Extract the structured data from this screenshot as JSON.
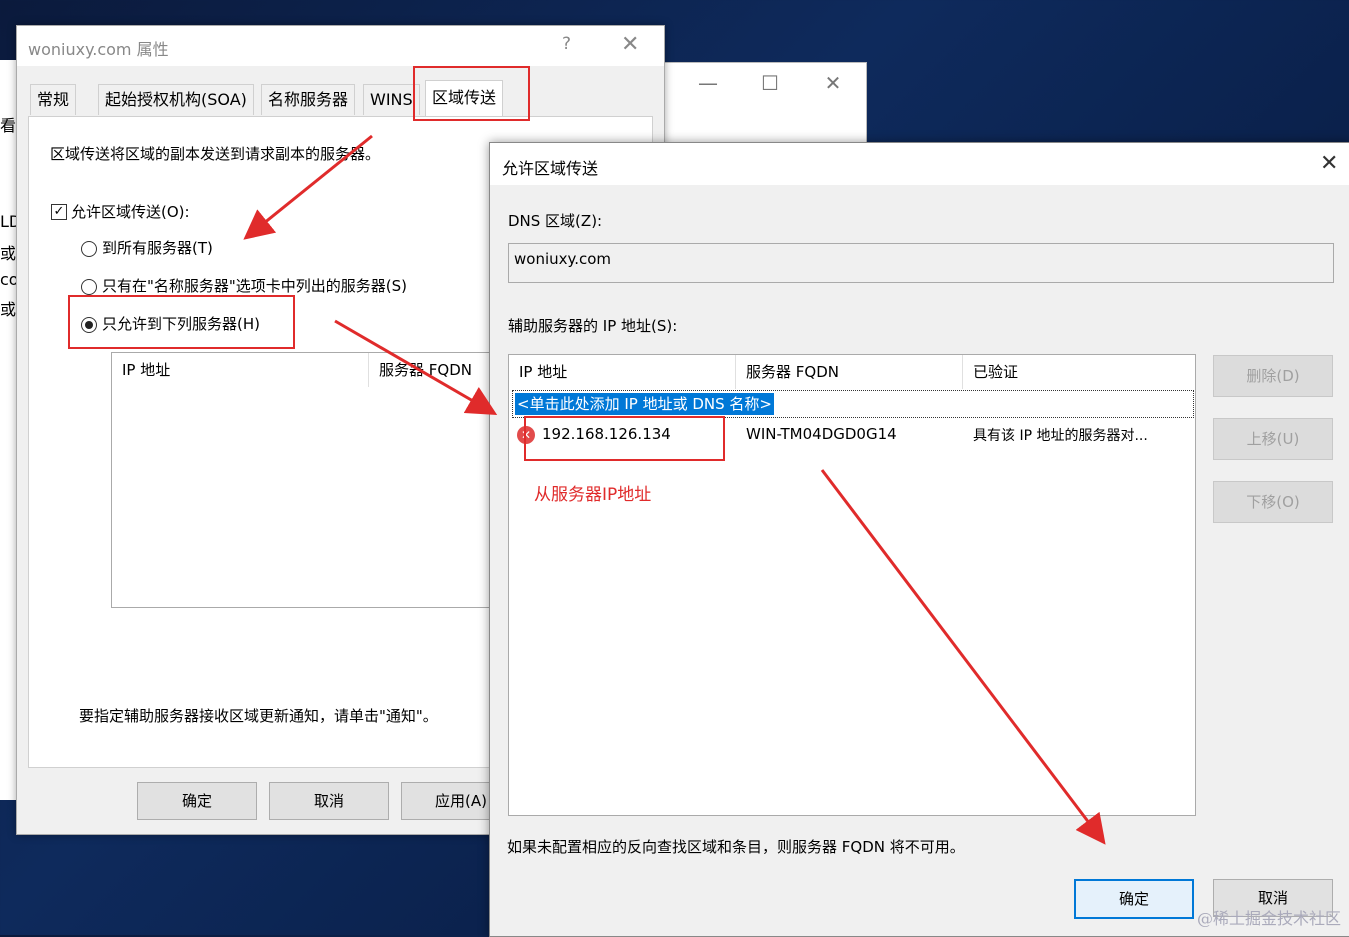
{
  "background": {
    "left_fragments": [
      "看",
      "LD",
      "或",
      "co",
      "或"
    ]
  },
  "props_dialog": {
    "title": "woniuxy.com 属性",
    "help": "?",
    "close": "✕",
    "tabs": [
      "常规",
      "起始授权机构(SOA)",
      "名称服务器",
      "WINS",
      "区域传送"
    ],
    "description": "区域传送将区域的副本发送到请求副本的服务器。",
    "allow_checkbox": "允许区域传送(O):",
    "radio_all": "到所有服务器(T)",
    "radio_ns": "只有在\"名称服务器\"选项卡中列出的服务器(S)",
    "radio_list": "只允许到下列服务器(H)",
    "list_headers": [
      "IP 地址",
      "服务器 FQDN"
    ],
    "notify_text": "要指定辅助服务器接收区域更新通知，请单击\"通知\"。",
    "buttons": {
      "ok": "确定",
      "cancel": "取消",
      "apply": "应用(A)"
    }
  },
  "xfer_dialog": {
    "title": "允许区域传送",
    "close": "✕",
    "dns_zone_label": "DNS 区域(Z):",
    "dns_zone_value": "woniuxy.com",
    "secondary_label": "辅助服务器的 IP 地址(S):",
    "headers": [
      "IP 地址",
      "服务器 FQDN",
      "已验证"
    ],
    "add_placeholder": "<单击此处添加 IP 地址或 DNS 名称>",
    "entry": {
      "ip": "192.168.126.134",
      "fqdn": "WIN-TM04DGD0G14",
      "verified": "具有该 IP 地址的服务器对..."
    },
    "side_buttons": {
      "delete": "删除(D)",
      "up": "上移(U)",
      "down": "下移(O)"
    },
    "footer_note": "如果未配置相应的反向查找区域和条目，则服务器 FQDN 将不可用。",
    "buttons": {
      "ok": "确定",
      "cancel": "取消"
    }
  },
  "annotation": {
    "text": "从服务器IP地址"
  },
  "watermark": "@稀土掘金技术社区",
  "colors": {
    "accent": "#0078d7",
    "annotation": "#e02b2b"
  }
}
